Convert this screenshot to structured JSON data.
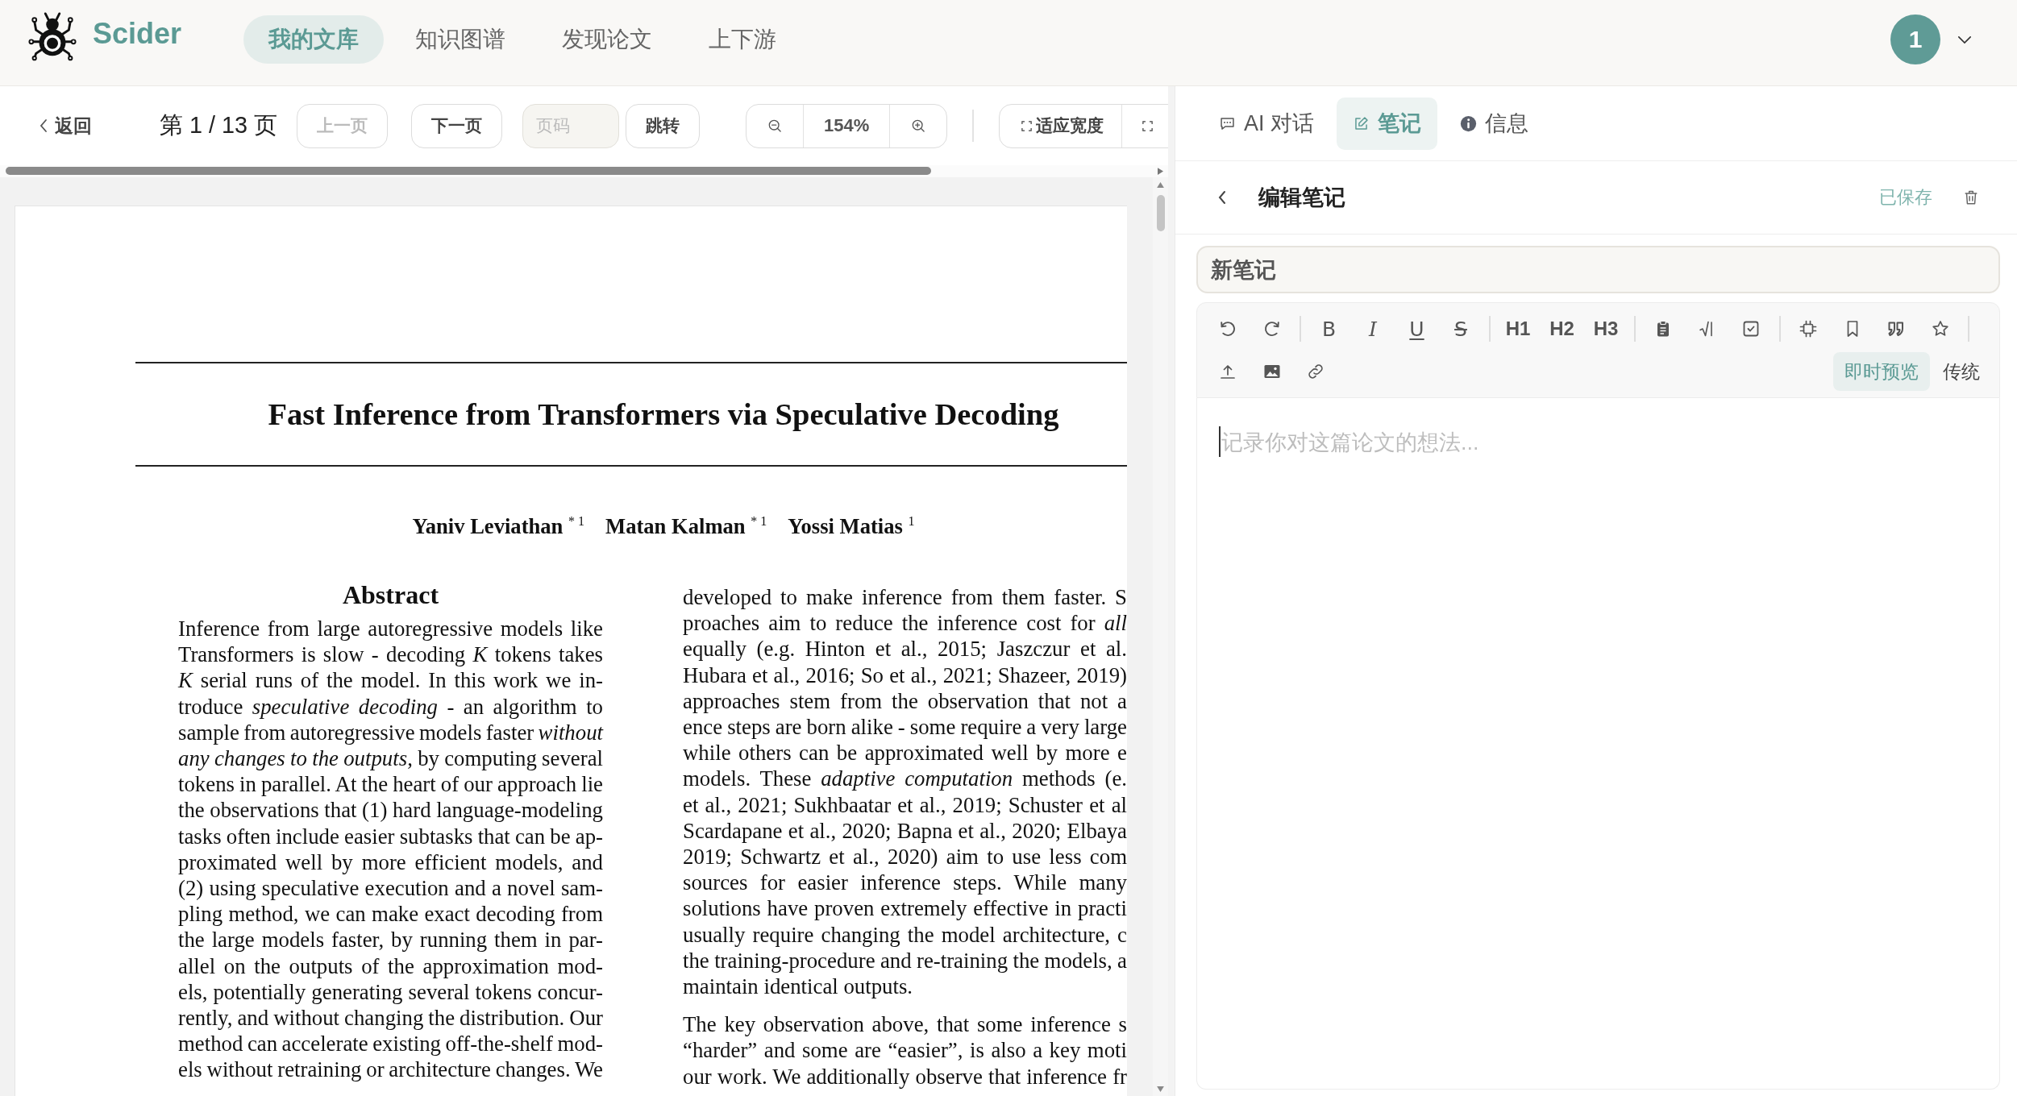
{
  "header": {
    "brand": "Scider",
    "nav": [
      {
        "label": "我的文库",
        "selected": true
      },
      {
        "label": "知识图谱",
        "selected": false
      },
      {
        "label": "发现论文",
        "selected": false
      },
      {
        "label": "上下游",
        "selected": false
      }
    ],
    "avatar": "1"
  },
  "viewer_toolbar": {
    "back": "返回",
    "page_indicator": "第 1 / 13 页",
    "pager": [
      {
        "label": "上一页",
        "disabled": true
      },
      {
        "label": "下一页",
        "disabled": false
      }
    ],
    "page_input": {
      "placeholder": "页码"
    },
    "go": "跳转",
    "zoom_level": "154%",
    "fit_width": "适应宽度"
  },
  "document": {
    "title": "Fast Inference from Transformers via Speculative Decoding",
    "authors": [
      "Yaniv Leviathan $^{* 1}$",
      "Matan Kalman $^{* 1}$",
      "Yossi Matias $^{1}$"
    ],
    "abstract_heading": "Abstract",
    "left_column": {
      "lines": [
        "Inference from large autoregressive models like",
        "Transformers is slow - decoding *K* tokens takes",
        "*K* serial runs of the model. In this work we in-",
        "troduce *speculative decoding* - an algorithm to",
        "sample from autoregressive models faster *without*",
        "*any changes to the outputs*, by computing several",
        "tokens in parallel. At the heart of our approach lie",
        "the observations that (1) hard language-modeling",
        "tasks often include easier subtasks that can be ap-",
        "proximated well by more efficient models, and",
        "(2) using speculative execution and a novel sam-",
        "pling method, we can make exact decoding from",
        "the large models faster, by running them in par-",
        "allel on the outputs of the approximation mod-",
        "els, potentially generating several tokens concur-",
        "rently, and without changing the distribution. Our",
        "method can accelerate existing off-the-shelf mod-",
        "els without retraining or architecture changes. We"
      ]
    },
    "right_column": [
      {
        "lines": [
          "developed to make inference from them faster. S",
          "proaches aim to reduce the inference cost for *all*",
          "equally (e.g. Hinton et al., 2015; Jaszczur et al.",
          "Hubara et al., 2016; So et al., 2021; Shazeer, 2019)",
          "approaches stem from the observation that not a",
          "ence steps are born alike - some require a very large",
          "while others can be approximated well by more e",
          "models. These *adaptive computation* methods (e.",
          "et al., 2021; Sukhbaatar et al., 2019; Schuster et al",
          "Scardapane et al., 2020; Bapna et al., 2020; Elbaya",
          "2019; Schwartz et al., 2020) aim to use less com",
          "sources for easier inference steps. While many",
          "solutions have proven extremely effective in practi",
          "usually require changing the model architecture, c",
          "the training-procedure and re-training the models, a",
          "maintain identical outputs."
        ]
      },
      {
        "lines": [
          "The key observation above, that some inference s",
          "“harder” and some are “easier”, is also a key moti",
          "our work. We additionally observe that inference fr"
        ]
      }
    ]
  },
  "side_panel": {
    "tabs": [
      {
        "label": "AI 对话",
        "selected": false
      },
      {
        "label": "笔记",
        "selected": true
      },
      {
        "label": "信息",
        "selected": false
      }
    ],
    "note_header": {
      "title": "编辑笔记",
      "status": "已保存"
    },
    "note_title": {
      "value": "新笔记"
    },
    "editor": {
      "format_buttons": [
        {
          "kind": "bold",
          "label": "B"
        },
        {
          "kind": "italic",
          "label": "I"
        },
        {
          "kind": "underline",
          "label": "U"
        },
        {
          "kind": "strike",
          "label": "S"
        }
      ],
      "headings": [
        "H1",
        "H2",
        "H3"
      ],
      "modes": [
        {
          "label": "即时预览",
          "selected": true
        },
        {
          "label": "传统",
          "selected": false
        }
      ],
      "body": {
        "placeholder": "记录你对这篇论文的想法..."
      }
    }
  }
}
